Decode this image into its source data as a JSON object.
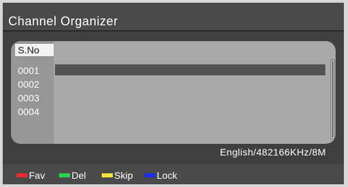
{
  "title": "Channel Organizer",
  "table": {
    "header": "S.No",
    "rows": [
      "0001",
      "0002",
      "0003",
      "0004"
    ],
    "selected_index": 0
  },
  "status": "English/482166KHz/8M",
  "legend": [
    {
      "label": "Fav",
      "color": "#e52b2b",
      "icon": "red-key"
    },
    {
      "label": "Del",
      "color": "#28d24c",
      "icon": "green-key"
    },
    {
      "label": "Skip",
      "color": "#f3e43c",
      "icon": "yellow-key"
    },
    {
      "label": "Lock",
      "color": "#1a2fe6",
      "icon": "blue-key"
    }
  ],
  "colors": {
    "screen_bg": "#3f3f3f",
    "panel_bg": "#a8a8a8",
    "selection_bar": "#525252"
  }
}
